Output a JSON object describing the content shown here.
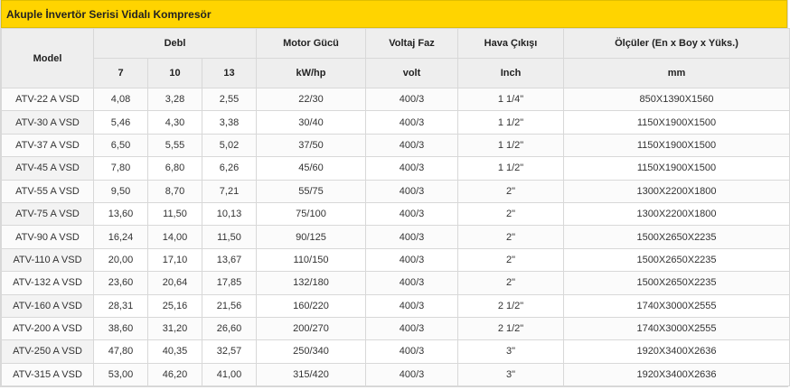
{
  "title": "Akuple İnvertör Serisi Vidalı Kompresör",
  "headers": {
    "model": "Model",
    "debi": "Debl",
    "motor": "Motor Gücü",
    "voltaj": "Voltaj Faz",
    "hava": "Hava Çıkışı",
    "olculer": "Ölçüler (En x Boy x Yüks.)"
  },
  "subheaders": {
    "p7": "7",
    "p10": "10",
    "p13": "13",
    "motor_unit": "kW/hp",
    "voltaj_unit": "volt",
    "hava_unit": "Inch",
    "olculer_unit": "mm"
  },
  "rows": [
    {
      "model": "ATV-22 A VSD",
      "d7": "4,08",
      "d10": "3,28",
      "d13": "2,55",
      "motor": "22/30",
      "volt": "400/3",
      "hava": "1 1/4\"",
      "dim": "850X1390X1560"
    },
    {
      "model": "ATV-30 A VSD",
      "d7": "5,46",
      "d10": "4,30",
      "d13": "3,38",
      "motor": "30/40",
      "volt": "400/3",
      "hava": "1 1/2\"",
      "dim": "1150X1900X1500"
    },
    {
      "model": "ATV-37 A VSD",
      "d7": "6,50",
      "d10": "5,55",
      "d13": "5,02",
      "motor": "37/50",
      "volt": "400/3",
      "hava": "1 1/2\"",
      "dim": "1150X1900X1500"
    },
    {
      "model": "ATV-45 A VSD",
      "d7": "7,80",
      "d10": "6,80",
      "d13": "6,26",
      "motor": "45/60",
      "volt": "400/3",
      "hava": "1 1/2\"",
      "dim": "1150X1900X1500"
    },
    {
      "model": "ATV-55 A VSD",
      "d7": "9,50",
      "d10": "8,70",
      "d13": "7,21",
      "motor": "55/75",
      "volt": "400/3",
      "hava": "2\"",
      "dim": "1300X2200X1800"
    },
    {
      "model": "ATV-75 A VSD",
      "d7": "13,60",
      "d10": "11,50",
      "d13": "10,13",
      "motor": "75/100",
      "volt": "400/3",
      "hava": "2\"",
      "dim": "1300X2200X1800"
    },
    {
      "model": "ATV-90 A VSD",
      "d7": "16,24",
      "d10": "14,00",
      "d13": "11,50",
      "motor": "90/125",
      "volt": "400/3",
      "hava": "2\"",
      "dim": "1500X2650X2235"
    },
    {
      "model": "ATV-110 A VSD",
      "d7": "20,00",
      "d10": "17,10",
      "d13": "13,67",
      "motor": "110/150",
      "volt": "400/3",
      "hava": "2\"",
      "dim": "1500X2650X2235"
    },
    {
      "model": "ATV-132 A VSD",
      "d7": "23,60",
      "d10": "20,64",
      "d13": "17,85",
      "motor": "132/180",
      "volt": "400/3",
      "hava": "2\"",
      "dim": "1500X2650X2235"
    },
    {
      "model": "ATV-160 A VSD",
      "d7": "28,31",
      "d10": "25,16",
      "d13": "21,56",
      "motor": "160/220",
      "volt": "400/3",
      "hava": "2 1/2\"",
      "dim": "1740X3000X2555"
    },
    {
      "model": "ATV-200 A VSD",
      "d7": "38,60",
      "d10": "31,20",
      "d13": "26,60",
      "motor": "200/270",
      "volt": "400/3",
      "hava": "2 1/2\"",
      "dim": "1740X3000X2555"
    },
    {
      "model": "ATV-250 A VSD",
      "d7": "47,80",
      "d10": "40,35",
      "d13": "32,57",
      "motor": "250/340",
      "volt": "400/3",
      "hava": "3\"",
      "dim": "1920X3400X2636"
    },
    {
      "model": "ATV-315 A VSD",
      "d7": "53,00",
      "d10": "46,20",
      "d13": "41,00",
      "motor": "315/420",
      "volt": "400/3",
      "hava": "3\"",
      "dim": "1920X3400X2636"
    }
  ]
}
